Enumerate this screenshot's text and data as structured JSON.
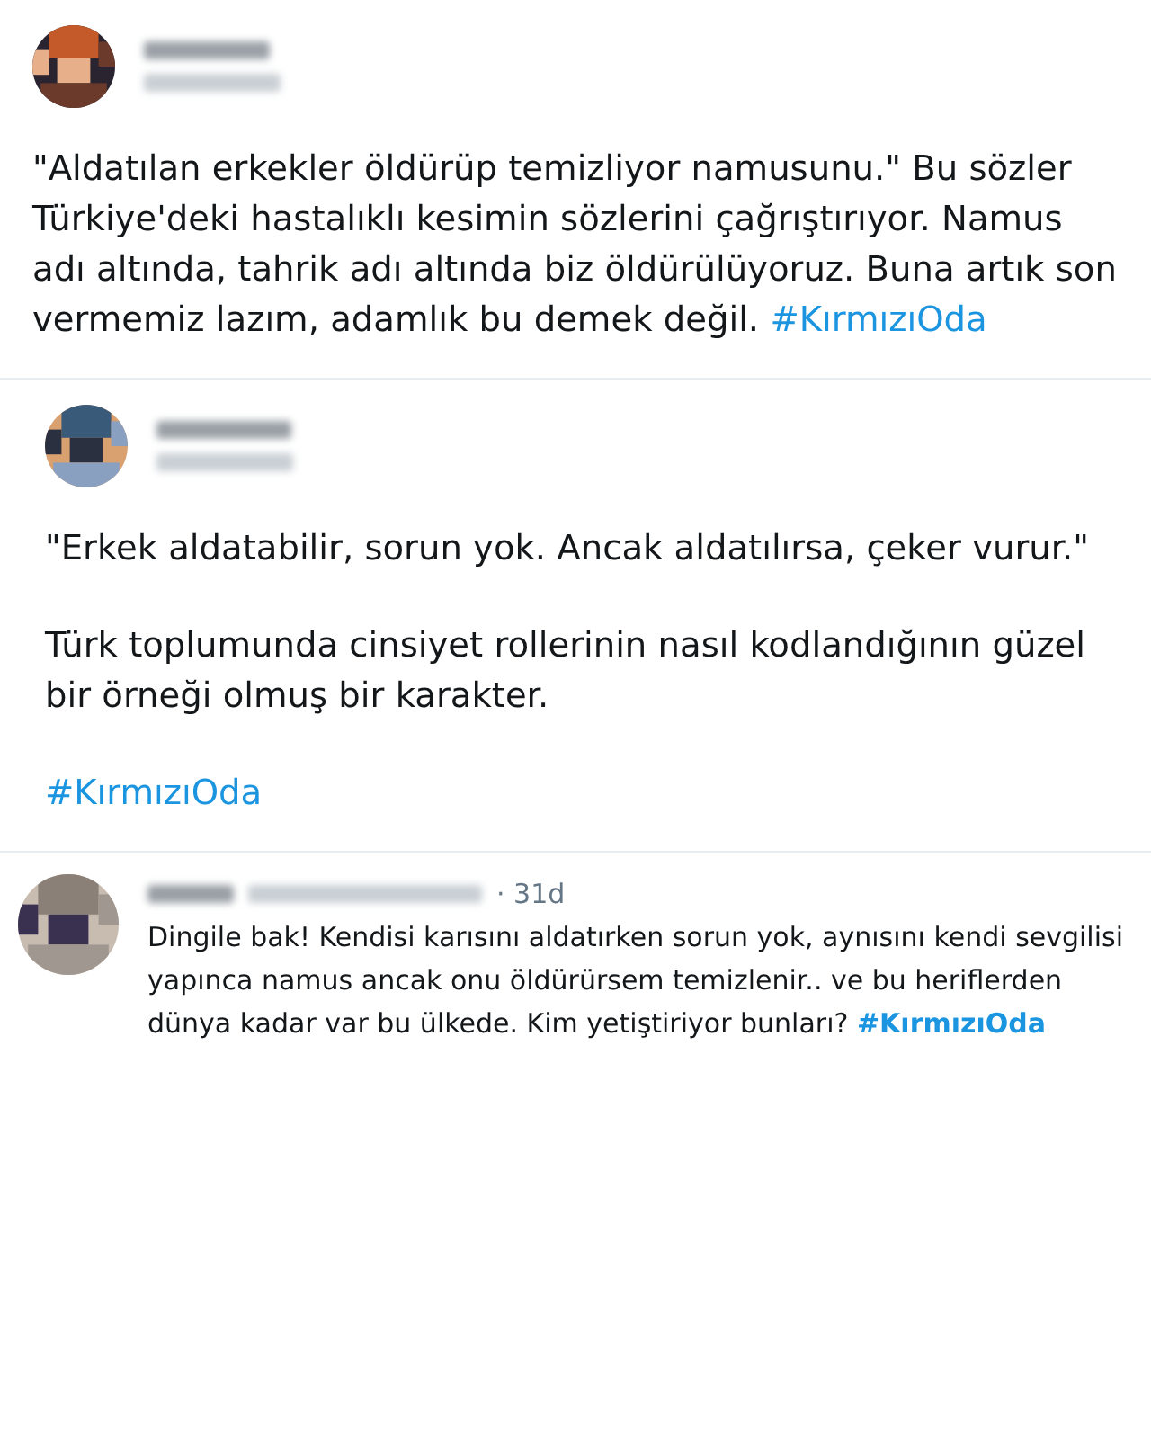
{
  "tweets": [
    {
      "kind": "large",
      "paragraphs": [
        {
          "text": "\"Aldatılan erkekler öldürüp temizliyor namusunu.\" Bu sözler Türkiye'deki hastalıklı kesimin sözlerini çağrıştırıyor. Namus adı altında, tahrik adı altında biz öldürülüyoruz. Buna artık son vermemiz lazım, adamlık bu demek değil.",
          "hashtag": "#KırmızıOda"
        }
      ]
    },
    {
      "kind": "nested",
      "paragraphs": [
        {
          "text": "\"Erkek aldatabilir, sorun yok. Ancak aldatılırsa, çeker vurur.\""
        },
        {
          "text": "Türk toplumunda cinsiyet rollerinin nasıl kodlandığının güzel bir örneği olmuş bir karakter."
        },
        {
          "hashtag": "#KırmızıOda"
        }
      ]
    },
    {
      "kind": "compact",
      "time": "· 31d",
      "paragraphs": [
        {
          "text": "Dingile bak! Kendisi karısını aldatırken sorun yok, aynısını kendi sevgilisi yapınca namus ancak onu öldürürsem temizlenir.. ve bu heriflerden dünya kadar var bu ülkede. Kim yetiştiriyor bunları?",
          "hashtag": "#KırmızıOda"
        }
      ]
    }
  ]
}
